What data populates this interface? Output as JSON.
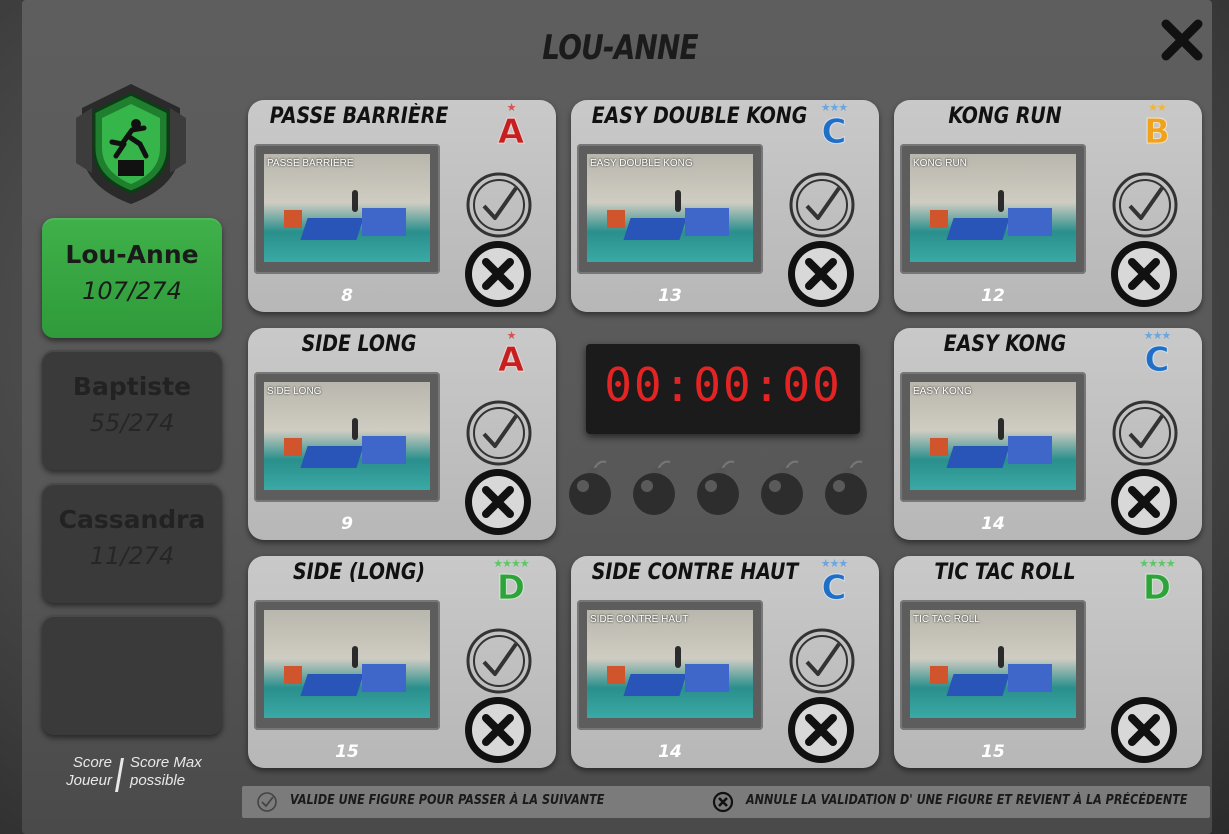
{
  "title": "LOU-ANNE",
  "players": [
    {
      "name": "Lou-Anne",
      "score": "107/274",
      "active": true
    },
    {
      "name": "Baptiste",
      "score": "55/274",
      "active": false
    },
    {
      "name": "Cassandra",
      "score": "11/274",
      "active": false
    },
    {
      "name": "",
      "score": "",
      "active": false
    }
  ],
  "score_legend": {
    "player": "Score Joueur",
    "max": "Score Max possible"
  },
  "timer": "00:00:00",
  "bomb_count": 5,
  "figures": [
    {
      "name": "PASSE BARRIÈRE",
      "video_title": "PASSE BARRIÈRE",
      "grade": "A",
      "stars": 1,
      "grade_color": "#c61f1f",
      "star_color": "#d95050",
      "points": "8",
      "validate_visible": true
    },
    {
      "name": "EASY DOUBLE KONG",
      "video_title": "EASY DOUBLE KONG",
      "grade": "C",
      "stars": 3,
      "grade_color": "#1f6fc7",
      "star_color": "#6aa6e0",
      "points": "13",
      "validate_visible": true
    },
    {
      "name": "KONG RUN",
      "video_title": "KONG RUN",
      "grade": "B",
      "stars": 2,
      "grade_color": "#f0a21a",
      "star_color": "#f0b63a",
      "points": "12",
      "validate_visible": true
    },
    {
      "name": "SIDE LONG",
      "video_title": "SIDE LONG",
      "grade": "A",
      "stars": 1,
      "grade_color": "#c61f1f",
      "star_color": "#d95050",
      "points": "9",
      "validate_visible": true
    },
    {
      "name": "EASY KONG",
      "video_title": "EASY KONG",
      "grade": "C",
      "stars": 3,
      "grade_color": "#1f6fc7",
      "star_color": "#6aa6e0",
      "points": "14",
      "validate_visible": true
    },
    {
      "name": "SIDE (LONG)",
      "video_title": "",
      "grade": "D",
      "stars": 4,
      "grade_color": "#2ea33a",
      "star_color": "#5cc766",
      "points": "15",
      "validate_visible": true
    },
    {
      "name": "SIDE CONTRE HAUT",
      "video_title": "SIDE CONTRE HAUT",
      "grade": "C",
      "stars": 3,
      "grade_color": "#1f6fc7",
      "star_color": "#6aa6e0",
      "points": "14",
      "validate_visible": true
    },
    {
      "name": "TIC TAC ROLL",
      "video_title": "TIC TAC ROLL",
      "grade": "D",
      "stars": 4,
      "grade_color": "#2ea33a",
      "star_color": "#5cc766",
      "points": "15",
      "validate_visible": false
    }
  ],
  "footer": {
    "validate_hint": "VALIDE UNE FIGURE POUR PASSER À LA SUIVANTE",
    "cancel_hint": "ANNULE LA VALIDATION D' UNE FIGURE ET REVIENT À LA PRÉCÉDENTE"
  },
  "colors": {
    "active_player": "#34a340",
    "timer_digits": "#e32424"
  }
}
